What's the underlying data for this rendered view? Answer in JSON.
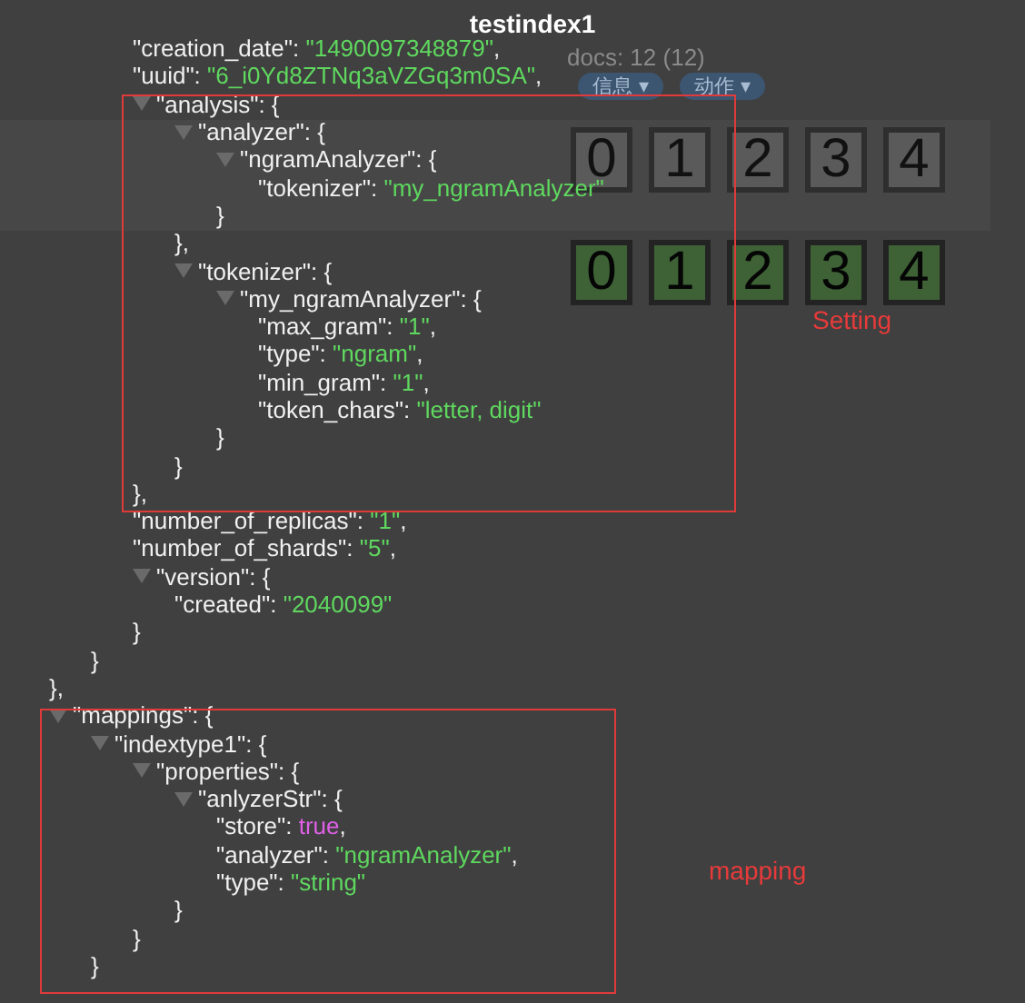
{
  "window": {
    "title": "testindex1"
  },
  "background_page": {
    "docs": "docs: 12 (12)",
    "buttons": [
      "信息 ▾",
      "动作 ▾"
    ],
    "shard_rows": [
      {
        "kind": "plain",
        "groups": [
          [
            "0",
            "1",
            "2",
            "3",
            "4"
          ]
        ]
      },
      {
        "kind": "green",
        "groups": [
          [
            "0",
            "1",
            "2",
            "3",
            "4"
          ]
        ]
      }
    ]
  },
  "tree": [
    {
      "close": "},",
      "children": [
        {
          "close": "}",
          "children": [
            {
              "key": "\"creation_date\": ",
              "value": "\"1490097348879\"",
              "kind": "string",
              "tail": ","
            },
            {
              "key": "\"uuid\": ",
              "value": "\"6_i0Yd8ZTNq3aVZGq3m0SA\"",
              "kind": "string",
              "tail": ","
            },
            {
              "key": "\"analysis\": {",
              "expanded": true,
              "close": "},",
              "children": [
                {
                  "key": "\"analyzer\": {",
                  "expanded": true,
                  "close": "},",
                  "children": [
                    {
                      "key": "\"ngramAnalyzer\": {",
                      "expanded": true,
                      "close": "}",
                      "children": [
                        {
                          "key": "\"tokenizer\": ",
                          "value": "\"my_ngramAnalyzer\"",
                          "kind": "string"
                        }
                      ]
                    }
                  ]
                },
                {
                  "key": "\"tokenizer\": {",
                  "expanded": true,
                  "close": "}",
                  "children": [
                    {
                      "key": "\"my_ngramAnalyzer\": {",
                      "expanded": true,
                      "close": "}",
                      "children": [
                        {
                          "key": "\"max_gram\": ",
                          "value": "\"1\"",
                          "kind": "string",
                          "tail": ","
                        },
                        {
                          "key": "\"type\": ",
                          "value": "\"ngram\"",
                          "kind": "string",
                          "tail": ","
                        },
                        {
                          "key": "\"min_gram\": ",
                          "value": "\"1\"",
                          "kind": "string",
                          "tail": ","
                        },
                        {
                          "key": "\"token_chars\": ",
                          "value": "\"letter, digit\"",
                          "kind": "string"
                        }
                      ]
                    }
                  ]
                }
              ]
            },
            {
              "key": "\"number_of_replicas\": ",
              "value": "\"1\"",
              "kind": "string",
              "tail": ","
            },
            {
              "key": "\"number_of_shards\": ",
              "value": "\"5\"",
              "kind": "string",
              "tail": ","
            },
            {
              "key": "\"version\": {",
              "expanded": true,
              "close": "}",
              "children": [
                {
                  "key": "\"created\": ",
                  "value": "\"2040099\"",
                  "kind": "string"
                }
              ]
            }
          ]
        }
      ]
    },
    {
      "key": "\"mappings\": {",
      "expanded": true,
      "children": [
        {
          "key": "\"indextype1\": {",
          "expanded": true,
          "close": "}",
          "children": [
            {
              "key": "\"properties\": {",
              "expanded": true,
              "close": "}",
              "children": [
                {
                  "key": "\"anlyzerStr\": {",
                  "expanded": true,
                  "close": "}",
                  "children": [
                    {
                      "key": "\"store\": ",
                      "value": "true",
                      "kind": "bool",
                      "tail": ","
                    },
                    {
                      "key": "\"analyzer\": ",
                      "value": "\"ngramAnalyzer\"",
                      "kind": "string",
                      "tail": ","
                    },
                    {
                      "key": "\"type\": ",
                      "value": "\"string\"",
                      "kind": "string"
                    }
                  ]
                }
              ]
            }
          ]
        }
      ]
    }
  ],
  "annotations": [
    {
      "label": "Setting"
    },
    {
      "label": "mapping"
    }
  ]
}
